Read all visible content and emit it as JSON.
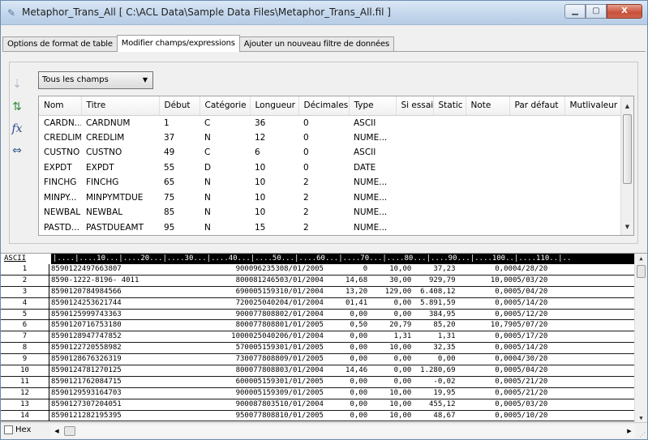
{
  "window": {
    "title": "Metaphor_Trans_All [ C:\\ACL Data\\Sample Data Files\\Metaphor_Trans_All.fil ]",
    "min_label": "▁",
    "max_label": "▢",
    "close_label": "X"
  },
  "tabs": [
    {
      "label": "Options de format de table"
    },
    {
      "label": "Modifier champs/expressions"
    },
    {
      "label": "Ajouter un nouveau filtre de données"
    }
  ],
  "filter": {
    "selected": "Tous les champs"
  },
  "fields_table": {
    "columns": [
      "Nom",
      "Titre",
      "Début",
      "Catégorie",
      "Longueur",
      "Décimales",
      "Type",
      "Si essai",
      "Static",
      "Note",
      "Par défaut",
      "Mutlivaleur"
    ],
    "rows": [
      [
        "CARDN...",
        "CARDNUM",
        "1",
        "C",
        "36",
        "0",
        "ASCII",
        "",
        "",
        "",
        "",
        ""
      ],
      [
        "CREDLIM",
        "CREDLIM",
        "37",
        "N",
        "12",
        "0",
        "NUME...",
        "",
        "",
        "",
        "",
        ""
      ],
      [
        "CUSTNO",
        "CUSTNO",
        "49",
        "C",
        "6",
        "0",
        "ASCII",
        "",
        "",
        "",
        "",
        ""
      ],
      [
        "EXPDT",
        "EXPDT",
        "55",
        "D",
        "10",
        "0",
        "DATE",
        "",
        "",
        "",
        "",
        ""
      ],
      [
        "FINCHG",
        "FINCHG",
        "65",
        "N",
        "10",
        "2",
        "NUME...",
        "",
        "",
        "",
        "",
        ""
      ],
      [
        "MINPY...",
        "MINPYMTDUE",
        "75",
        "N",
        "10",
        "2",
        "NUME...",
        "",
        "",
        "",
        "",
        ""
      ],
      [
        "NEWBAL",
        "NEWBAL",
        "85",
        "N",
        "10",
        "2",
        "NUME...",
        "",
        "",
        "",
        "",
        ""
      ],
      [
        "PASTD...",
        "PASTDUEAMT",
        "95",
        "N",
        "15",
        "2",
        "NUME...",
        "",
        "",
        "",
        "",
        ""
      ]
    ]
  },
  "raw_view": {
    "label": "ASCII",
    "ruler": "|....|....10...|....20...|....30...|....40...|....50...|....60...|....70...|....80...|....90...|....100..|....110..|..",
    "rows": [
      {
        "n": "1",
        "data": "8590122497663807                          900096235308/01/2005         0     10,00     37,23         0,0004/28/20"
      },
      {
        "n": "2",
        "data": "8590-1222-8196- 4011                      800081246503/01/2004     14,68     30,00    929,79        10,0005/03/20"
      },
      {
        "n": "3",
        "data": "8590120784984566                          690005159310/01/2004     13,20    129,00  6.408,12         0,0005/04/20"
      },
      {
        "n": "4",
        "data": "8590124253621744                          720025040204/01/2004     01,41      0,00  5.891,59         0,0005/14/20"
      },
      {
        "n": "5",
        "data": "8590125999743363                          900077808802/01/2004      0,00      0,00    384,95         0,0005/12/20"
      },
      {
        "n": "6",
        "data": "8590120716753180                          800077808801/01/2005      0,50     20,79     85,20        10,7905/07/20"
      },
      {
        "n": "7",
        "data": "8590128947747852                         1000025040206/01/2004      0,00      1,31      1,31         0,0005/17/20"
      },
      {
        "n": "8",
        "data": "8590122720558982                          570005159301/01/2005      0,00     10,00     32,35         0,0005/14/20"
      },
      {
        "n": "9",
        "data": "8590128676326319                          730077808809/01/2005      0,00      0,00      0,00         0,0004/30/20"
      },
      {
        "n": "10",
        "data": "8590124781270125                          800077808803/01/2004     14,46      0,00  1.280,69         0,0005/04/20"
      },
      {
        "n": "11",
        "data": "8590121762084715                          600005159301/01/2005      0,00      0,00     -0,02         0,0005/21/20"
      },
      {
        "n": "12",
        "data": "8590129593164703                          900005159309/01/2005      0,00     10,00     19,95         0,0005/21/20"
      },
      {
        "n": "13",
        "data": "8590127307204051                          900087803510/01/2004      0,00     10,00    455,12         0,0005/03/20"
      },
      {
        "n": "14",
        "data": "8590121282195395                          950077808810/01/2005      0,00     10,00     48,67         0,0005/10/20"
      }
    ]
  },
  "footer": {
    "hex_label": "Hex"
  }
}
